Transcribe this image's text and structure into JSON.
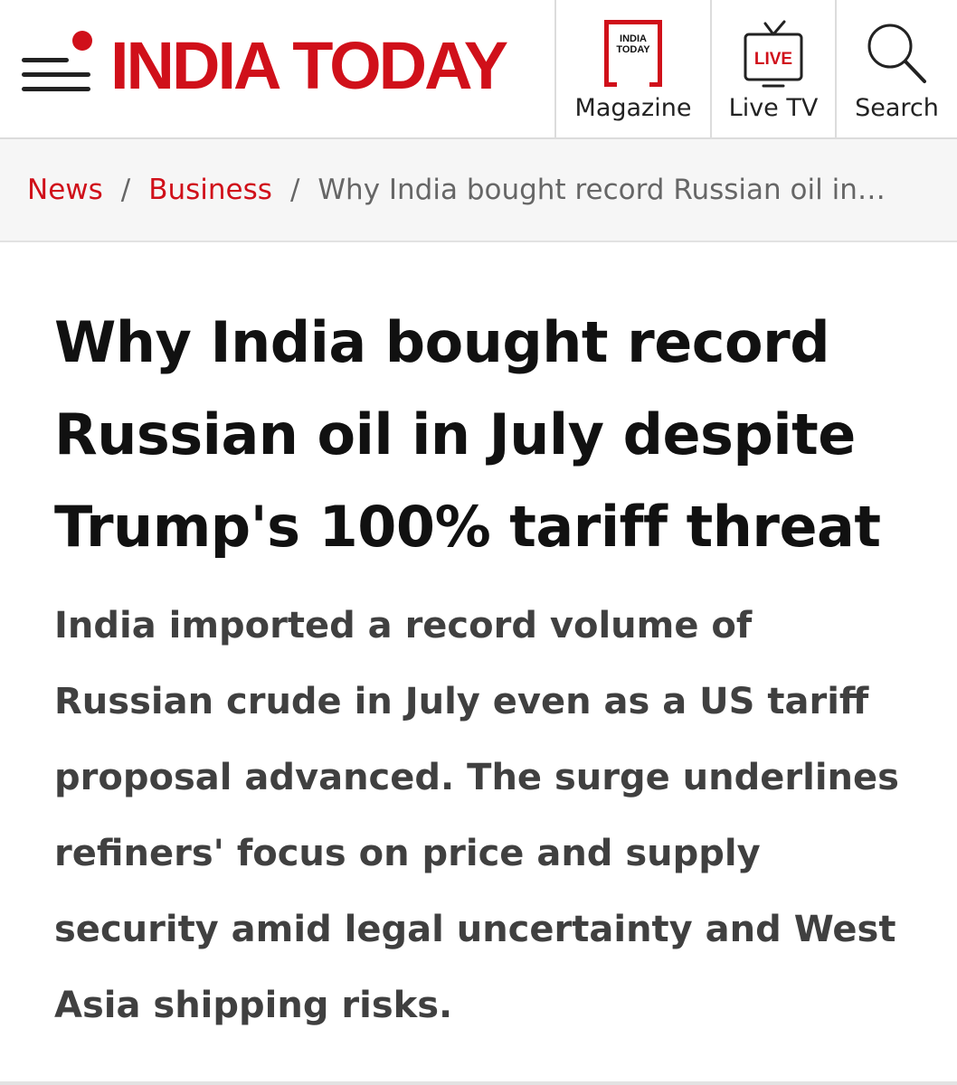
{
  "colors": {
    "brand_red": "#d0101a",
    "text_dark": "#111111",
    "text_body": "#404040",
    "text_muted": "#666666"
  },
  "header": {
    "menu_icon": "hamburger-menu-icon",
    "logo_text": "INDIA TODAY",
    "nav": [
      {
        "label": "Magazine",
        "icon": "india-today-magazine-icon",
        "icon_text": "INDIA TODAY"
      },
      {
        "label": "Live TV",
        "icon": "live-tv-icon",
        "icon_text": "LIVE"
      },
      {
        "label": "Search",
        "icon": "search-icon"
      }
    ]
  },
  "breadcrumb": {
    "items": [
      "News",
      "Business"
    ],
    "separator": "/",
    "current": "Why India bought record Russian oil in…"
  },
  "article": {
    "headline": "Why India bought record Russian oil in July despite Trump's 100% tariff threat",
    "summary": "India imported a record volume of Russian crude in July even as a US tariff proposal advanced. The surge underlines refiners' focus on price and supply security amid legal uncertainty and West Asia shipping risks."
  }
}
